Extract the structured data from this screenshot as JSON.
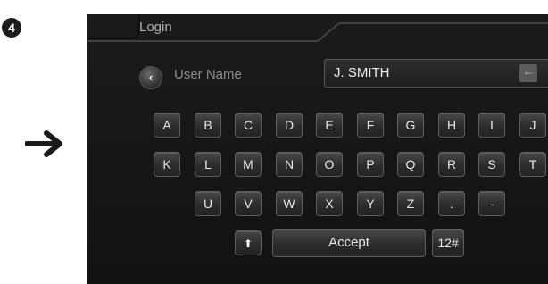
{
  "step_number": "4",
  "window": {
    "title": "Login"
  },
  "field": {
    "back_icon": "chevron-left-icon",
    "label": "User Name",
    "value": "J. SMITH",
    "backspace_icon": "backspace-arrow-icon"
  },
  "keyboard": {
    "row1": [
      "A",
      "B",
      "C",
      "D",
      "E",
      "F",
      "G",
      "H",
      "I",
      "J"
    ],
    "row2": [
      "K",
      "L",
      "M",
      "N",
      "O",
      "P",
      "Q",
      "R",
      "S",
      "T"
    ],
    "row3": [
      "U",
      "V",
      "W",
      "X",
      "Y",
      "Z",
      ".",
      "-"
    ],
    "shift_icon": "shift-up-arrow-icon",
    "accept_label": "Accept",
    "numeric_label": "12#"
  },
  "colors": {
    "screen_bg": "#161616",
    "key_bg": "#3a3a3a",
    "text": "#e8e8e8"
  }
}
